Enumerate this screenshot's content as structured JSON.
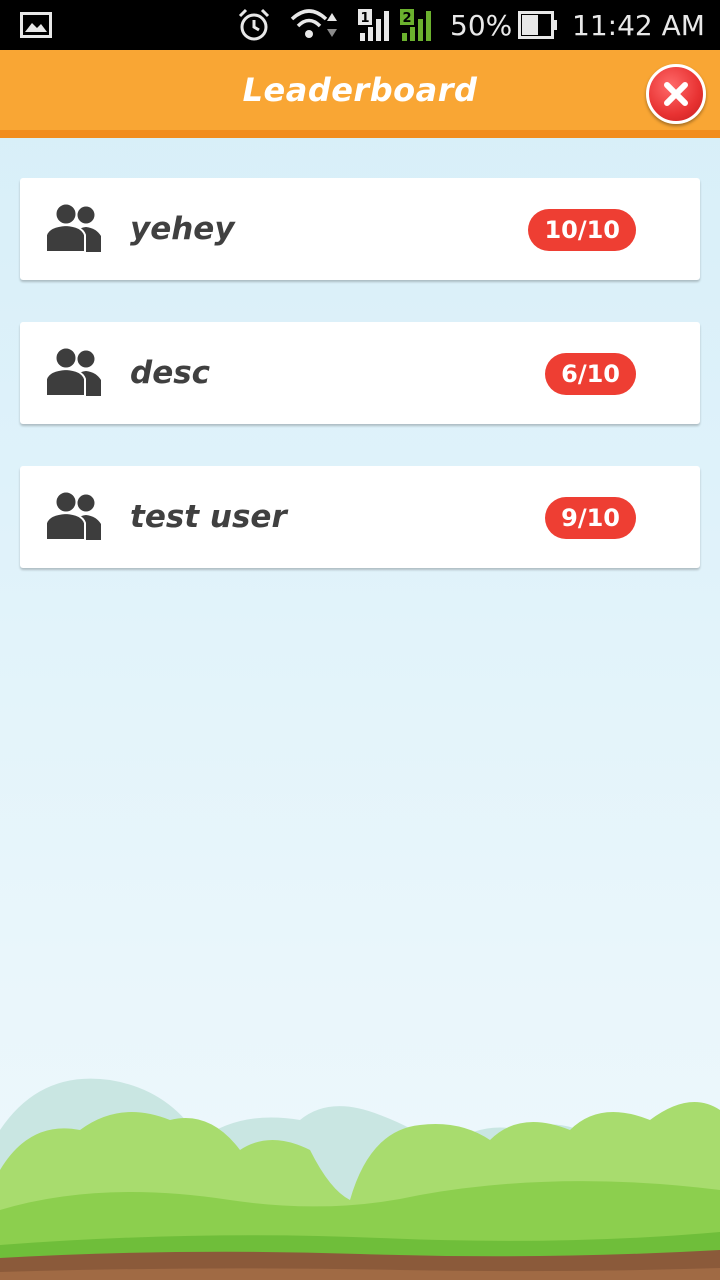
{
  "status_bar": {
    "battery": "50%",
    "time": "11:42 AM",
    "sim1": "1",
    "sim2": "2"
  },
  "header": {
    "title": "Leaderboard"
  },
  "leaderboard": [
    {
      "name": "yehey",
      "score": "10/10"
    },
    {
      "name": "desc",
      "score": "6/10"
    },
    {
      "name": "test user",
      "score": "9/10"
    }
  ],
  "colors": {
    "appbar": "#f9a634",
    "appbar_border": "#f28d1e",
    "score_badge": "#ee3e33",
    "close_button": "#e83232"
  }
}
